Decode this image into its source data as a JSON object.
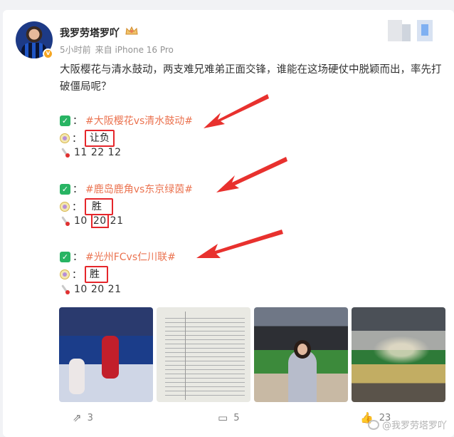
{
  "post": {
    "username": "我罗劳塔罗吖",
    "time": "5小时前",
    "source": "来自 iPhone 16 Pro",
    "text": "大阪樱花与清水鼓动，两支难兄难弟正面交锋，谁能在这场硬仗中脱颖而出，率先打破僵局呢？"
  },
  "picks": [
    {
      "topic": "#大阪樱花vs清水鼓动#",
      "result": "让负",
      "numbers": [
        "11",
        "22",
        "12"
      ]
    },
    {
      "topic": "#鹿岛鹿角vs东京绿茵#",
      "result": "胜",
      "numbers": [
        "10",
        "20",
        "21"
      ]
    },
    {
      "topic": "#光州FCvs仁川联#",
      "result": "胜",
      "numbers": [
        "10",
        "20",
        "21"
      ]
    }
  ],
  "icons": {
    "check": "✓",
    "separator": "：",
    "verified": "v"
  },
  "actions": {
    "repost_count": "3",
    "comment_count": "5",
    "like_count": "23"
  },
  "watermark": "@我罗劳塔罗吖",
  "colors": {
    "topic": "#eb7350",
    "highlight_box": "#e5262b",
    "arrow": "#e8312e",
    "checkbox": "#28b463"
  }
}
